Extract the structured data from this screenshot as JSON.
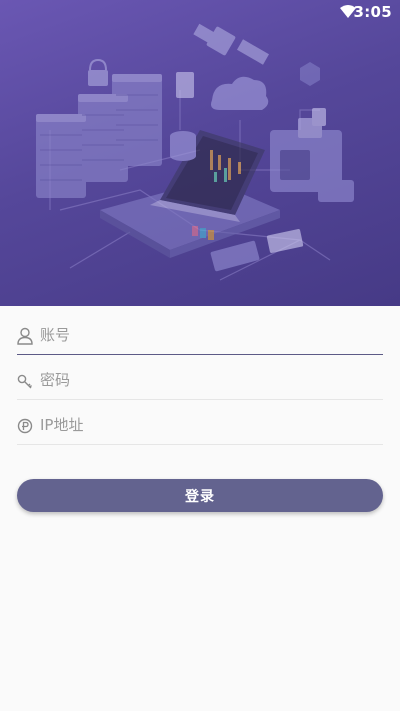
{
  "status_bar": {
    "time": "3:05",
    "wifi_icon": "wifi-icon"
  },
  "form": {
    "account_placeholder": "账号",
    "password_placeholder": "密码",
    "ip_placeholder": "IP地址",
    "account_icon": "user-icon",
    "password_icon": "key-icon",
    "ip_icon": "ip-icon"
  },
  "login_button": {
    "label": "登录"
  },
  "colors": {
    "hero_top": "#6a57b3",
    "hero_bottom": "#463a86",
    "button": "#63638f",
    "active_underline": "#5c5a86",
    "background": "#fafafa"
  }
}
